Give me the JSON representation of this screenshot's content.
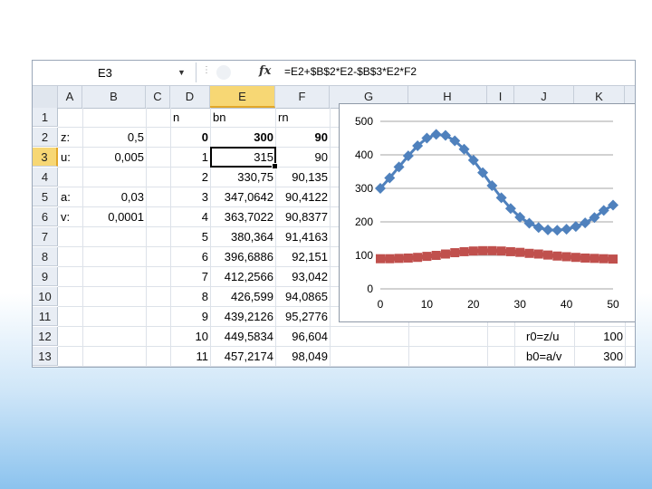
{
  "formula_bar": {
    "name_box": "E3",
    "formula": "=E2+$B$2*E2-$B$3*E2*F2",
    "fx_label": "fx"
  },
  "columns": [
    "A",
    "B",
    "C",
    "D",
    "E",
    "F",
    "G",
    "H",
    "I",
    "J",
    "K"
  ],
  "rows": [
    "1",
    "2",
    "3",
    "4",
    "5",
    "6",
    "7",
    "8",
    "9",
    "10",
    "11",
    "12",
    "13"
  ],
  "active_cell": "E3",
  "params": {
    "z_label": "z:",
    "z_value": "0,5",
    "u_label": "u:",
    "u_value": "0,005",
    "a_label": "a:",
    "a_value": "0,03",
    "v_label": "v:",
    "v_value": "0,0001"
  },
  "headers": {
    "n": "n",
    "bn": "bn",
    "rn": "rn"
  },
  "table": [
    {
      "n": "0",
      "bn": "300",
      "rn": "90"
    },
    {
      "n": "1",
      "bn": "315",
      "rn": "90"
    },
    {
      "n": "2",
      "bn": "330,75",
      "rn": "90,135"
    },
    {
      "n": "3",
      "bn": "347,0642",
      "rn": "90,4122"
    },
    {
      "n": "4",
      "bn": "363,7022",
      "rn": "90,8377"
    },
    {
      "n": "5",
      "bn": "380,364",
      "rn": "91,4163"
    },
    {
      "n": "6",
      "bn": "396,6886",
      "rn": "92,151"
    },
    {
      "n": "7",
      "bn": "412,2566",
      "rn": "93,042"
    },
    {
      "n": "8",
      "bn": "426,599",
      "rn": "94,0865"
    },
    {
      "n": "9",
      "bn": "439,2126",
      "rn": "95,2776"
    },
    {
      "n": "10",
      "bn": "449,5834",
      "rn": "96,604"
    },
    {
      "n": "11",
      "bn": "457,2174",
      "rn": "98,049"
    }
  ],
  "extra": {
    "r0_label": "r0=z/u",
    "r0_value": "100",
    "b0_label": "b0=a/v",
    "b0_value": "300"
  },
  "chart_data": {
    "type": "line",
    "x": [
      0,
      2,
      4,
      6,
      8,
      10,
      12,
      14,
      16,
      18,
      20,
      22,
      24,
      26,
      28,
      30,
      32,
      34,
      36,
      38,
      40,
      42,
      44,
      46,
      48,
      50
    ],
    "series": [
      {
        "color": "#4f81bd",
        "marker": "diamond",
        "values": [
          300,
          331,
          364,
          397,
          427,
          450,
          461,
          458,
          442,
          417,
          384,
          347,
          308,
          272,
          240,
          214,
          196,
          183,
          176,
          175,
          178,
          186,
          197,
          213,
          234,
          250
        ]
      },
      {
        "color": "#c0504d",
        "marker": "square",
        "values": [
          90,
          90,
          91,
          92,
          94,
          97,
          100,
          104,
          108,
          111,
          113,
          114,
          114,
          113,
          111,
          109,
          106,
          104,
          101,
          98,
          96,
          94,
          92,
          91,
          90,
          89
        ]
      }
    ],
    "x_ticks": [
      "0",
      "10",
      "20",
      "30",
      "40",
      "50"
    ],
    "y_ticks": [
      "0",
      "100",
      "200",
      "300",
      "400",
      "500"
    ],
    "xlim": [
      0,
      50
    ],
    "ylim": [
      0,
      500
    ],
    "grid": true,
    "legend": "none"
  }
}
